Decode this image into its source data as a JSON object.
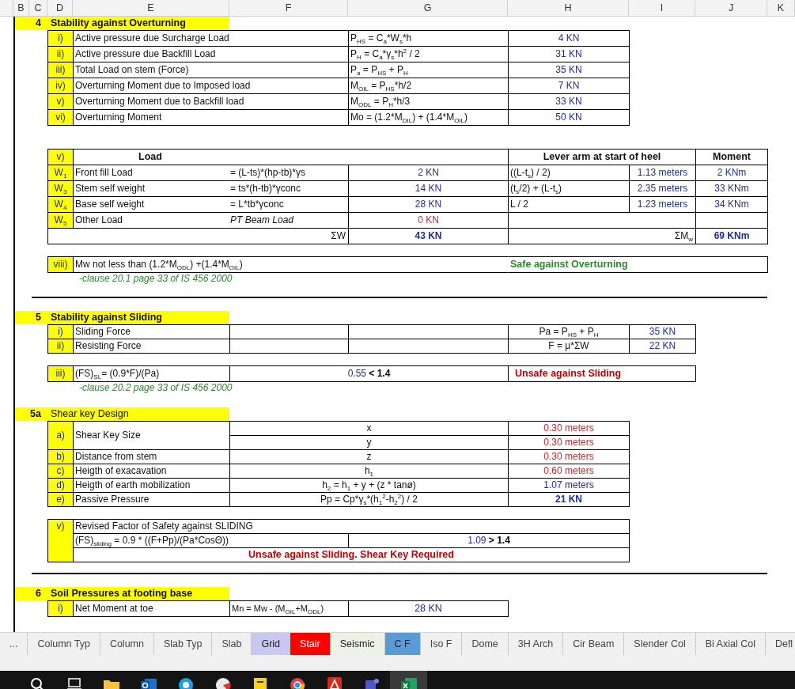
{
  "columns": [
    "B",
    "C",
    "D",
    "E",
    "F",
    "G",
    "H",
    "I",
    "J",
    "K"
  ],
  "blocks": [
    {
      "kind": "title",
      "number": "4",
      "text": "Stability against Overturning",
      "bold": true
    },
    {
      "kind": "items",
      "rows": [
        {
          "index": "i)",
          "label": "Active pressure due Surcharge Load",
          "formula": "P$_{HS}$ = C$_{a}$*W$_{s}$*h",
          "value": "4 KN"
        },
        {
          "index": "ii)",
          "label": "Active pressure due Backfill Load",
          "formula": "P$_{H}$ = C$_{a}$*γ$_{s}$*h$^{2}$ / 2",
          "value": "31 KN"
        },
        {
          "index": "iii)",
          "label": "Total Load on stem (Force)",
          "formula": "P$_{a}$ = P$_{HS}$ + P$_{H}$",
          "value": "35 KN"
        },
        {
          "index": "iv)",
          "label": "Overturning Moment due to Imposed load",
          "formula": "M$_{OIL}$ = P$_{HS}$*h/2",
          "value": "7 KN"
        },
        {
          "index": "v)",
          "label": "Overturning Moment due to Backfill load",
          "formula": "M$_{ODL}$ = P$_{H}$*h/3",
          "value": "33 KN"
        },
        {
          "index": "vi)",
          "label": "Overturning Moment",
          "formula": "Mo = (1.2*M$_{DIL}$) + (1.4*M$_{OIL}$)",
          "value": "50 KN"
        }
      ]
    },
    {
      "kind": "weights",
      "header": {
        "index": "v)",
        "load": "Load",
        "lever": "Lever arm at start of heel",
        "moment": "Moment"
      },
      "rows": [
        {
          "index": "W$_{1}$",
          "label": "Front fill Load",
          "formula": "= (L-ts)*(hp-tb)*γs",
          "formula_italic": false,
          "weight": {
            "text": "2 KN",
            "kind": "plain"
          },
          "arm_formula": "((L-t$_{s}$) / 2)",
          "arm": "1.13 meters",
          "moment": "2 KNm"
        },
        {
          "index": "W$_{3}$",
          "label": "Stem self weight",
          "formula": "= ts*(h-tb)*γconc",
          "formula_italic": false,
          "weight": {
            "text": "14 KN",
            "kind": "plain"
          },
          "arm_formula": "(t$_{s}$/2) + (L-t$_{s}$)",
          "arm": "2.35 meters",
          "moment": "33 KNm"
        },
        {
          "index": "W$_{4}$",
          "label": "Base  self weight",
          "formula": "= L*tb*γconc",
          "formula_italic": false,
          "weight": {
            "text": "28 KN",
            "kind": "plain"
          },
          "arm_formula": "L / 2",
          "arm": "1.23 meters",
          "moment": "34 KNm"
        },
        {
          "index": "W$_{5}$",
          "label": "Other Load",
          "formula": "PT Beam Load",
          "formula_italic": true,
          "weight": {
            "text": "0 KN",
            "kind": "warn"
          }
        }
      ],
      "total": {
        "weight_symbol": "ΣW",
        "weight": "43 KN",
        "moment_symbol": "ΣM$_{w}$",
        "moment": "69 KNm"
      }
    },
    {
      "kind": "check",
      "index": "viii)",
      "text": "Mw not less than (1.2*M$_{ODL}$) +(1.4*M$_{OIL}$)",
      "verdict": {
        "text": "Safe against Overturning",
        "safe": true
      }
    },
    {
      "kind": "note",
      "text": "-clause 20.1 page 33 of IS 456 2000"
    },
    {
      "kind": "rule"
    },
    {
      "kind": "title",
      "number": "5",
      "text": "Stability against Sliding",
      "bold": true
    },
    {
      "kind": "forces",
      "rows": [
        {
          "index": "i)",
          "label": "Sliding Force",
          "formula": "Pa = P$_{HS}$ + P$_{H}$",
          "value": "35 KN"
        },
        {
          "index": "ii)",
          "label": "Resisting Force",
          "formula": "F = μ*ΣW",
          "value": "22 KN"
        }
      ]
    },
    {
      "kind": "ratio",
      "index": "iii)",
      "formula": "(FS)$_{SL}$= (0.9*F)/(Pa)",
      "value": "0.55 **< 1.4**",
      "verdict": {
        "text": "Unsafe against Sliding",
        "safe": false
      }
    },
    {
      "kind": "note",
      "text": "-clause 20.2 page 33 of IS 456 2000"
    },
    {
      "kind": "title",
      "number": "5a",
      "text": "Shear key Design",
      "bold": false
    },
    {
      "kind": "key",
      "rows": [
        {
          "index": "a)",
          "label": "Shear Key Size",
          "parts": [
            {
              "formula": "x",
              "value": {
                "text": "0.30 meters",
                "kind": "warn"
              }
            },
            {
              "formula": "y",
              "value": {
                "text": "0.30 meters",
                "kind": "warn"
              }
            }
          ]
        },
        {
          "index": "b)",
          "label": "Distance from stem",
          "parts": [
            {
              "formula": "z",
              "value": {
                "text": "0.30 meters",
                "kind": "warn"
              }
            }
          ]
        },
        {
          "index": "c)",
          "label": "Heigth of exacavation",
          "parts": [
            {
              "formula": "h$_{1}$",
              "value": {
                "text": "0.60 meters",
                "kind": "warn"
              }
            }
          ]
        },
        {
          "index": "d)",
          "label": "Heigth of earth mobilization",
          "parts": [
            {
              "formula": "h$_{2}$ = h$_{1}$ +  y + (z * tanø)",
              "value": {
                "text": "1.07 meters",
                "kind": "plain"
              }
            }
          ]
        },
        {
          "index": "e)",
          "label": "Passive Pressure",
          "parts": [
            {
              "formula": "Pp = Cp*γ$_{s}$*(h$_{1}$$^{2}$-h$_{2}$$^{2}$) / 2",
              "value": {
                "text": "21 KN",
                "kind": "strong"
              }
            }
          ]
        }
      ]
    },
    {
      "kind": "revised",
      "index": "v)",
      "title": "Revised Factor of Safety against SLIDING",
      "formula": "(FS)$_{sliding}$ = 0.9 * ((F+Pp)/(Pa*CosΘ))",
      "value": "1.09 **> 1.4**",
      "verdict": {
        "text": "Unsafe against Sliding. Shear Key Required",
        "safe": false
      }
    },
    {
      "kind": "rule"
    },
    {
      "kind": "title",
      "number": "6",
      "text": "Soil Pressures at footing base",
      "bold": true
    },
    {
      "kind": "items6",
      "rows": [
        {
          "index": "i)",
          "label": "Net Moment at toe",
          "formula": "Mn = Mw - (M$_{OIL}$+M$_{ODL}$)",
          "value": "28 KN"
        }
      ]
    }
  ],
  "sheet_tabs": [
    {
      "label": "..."
    },
    {
      "label": "Column Typ"
    },
    {
      "label": "Column"
    },
    {
      "label": "Slab Typ"
    },
    {
      "label": "Slab"
    },
    {
      "label": "Grid",
      "color": "#c8c8f0"
    },
    {
      "label": "Stair",
      "color": "#ff0000"
    },
    {
      "label": "Seismic",
      "color": "#eef2e4"
    },
    {
      "label": "C F",
      "color": "#5b9bd5"
    },
    {
      "label": "Iso F"
    },
    {
      "label": "Dome"
    },
    {
      "label": "3H Arch"
    },
    {
      "label": "Cir Beam"
    },
    {
      "label": "Slender Col"
    },
    {
      "label": "Bi Axial Col"
    },
    {
      "label": "Defl"
    }
  ],
  "taskbar": [
    {
      "kind": "search",
      "selected": false
    },
    {
      "kind": "taskview",
      "selected": false
    },
    {
      "kind": "folder",
      "selected": false
    },
    {
      "kind": "mail",
      "selected": false
    },
    {
      "kind": "chat",
      "selected": false
    },
    {
      "kind": "dish",
      "selected": false
    },
    {
      "kind": "note",
      "selected": false
    },
    {
      "kind": "browser",
      "selected": false
    },
    {
      "kind": "pdf",
      "selected": false
    },
    {
      "kind": "team",
      "selected": false
    },
    {
      "kind": "sheet",
      "selected": true
    }
  ]
}
